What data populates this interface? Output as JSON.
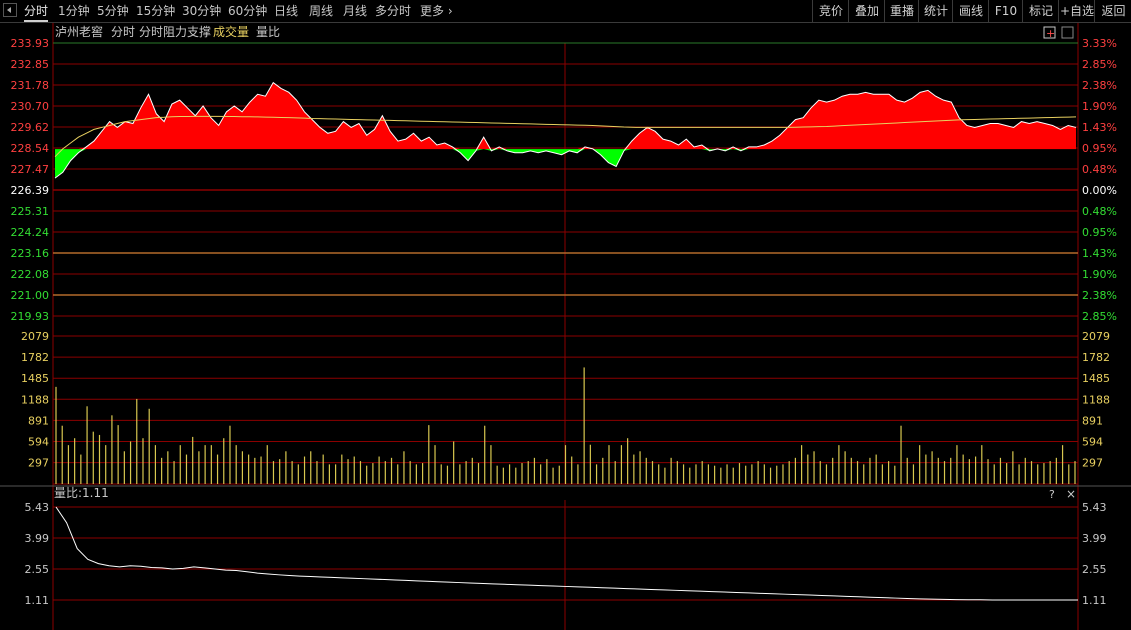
{
  "toolbar": {
    "tabs": [
      "分时",
      "1分钟",
      "5分钟",
      "15分钟",
      "30分钟",
      "60分钟",
      "日线",
      "周线",
      "月线",
      "多分时",
      "更多"
    ],
    "active_tab": "分时",
    "right_buttons": [
      "竞价",
      "叠加",
      "重播",
      "统计",
      "画线",
      "F10",
      "标记",
      "+自选",
      "返回"
    ]
  },
  "price_panel": {
    "stock_name": "泸州老窖",
    "labels": [
      "分时",
      "分时阻力支撑",
      "成交量",
      "量比"
    ],
    "left_axis": [
      "233.93",
      "232.85",
      "231.78",
      "230.70",
      "229.62",
      "228.54",
      "227.47",
      "226.39",
      "225.31",
      "224.24",
      "223.16",
      "222.08",
      "221.00",
      "219.93"
    ],
    "right_axis": [
      "3.33%",
      "2.85%",
      "2.38%",
      "1.90%",
      "1.43%",
      "0.95%",
      "0.48%",
      "0.00%",
      "0.48%",
      "0.95%",
      "1.43%",
      "1.90%",
      "2.38%",
      "2.85%"
    ],
    "prev_close": "226.39",
    "colors": {
      "up": "#ff0000",
      "down": "#00ff00",
      "axis_up": "#ff4040",
      "axis_down": "#33dd33",
      "flat": "#ffffff",
      "grid": "#8b0000",
      "avg_line": "#e8d060"
    }
  },
  "volume_panel": {
    "axis": [
      "2079",
      "1782",
      "1485",
      "1188",
      "891",
      "594",
      "297"
    ],
    "bar_color": "#d8c850"
  },
  "ratio_panel": {
    "title": "量比:1.11",
    "help": "?",
    "close": "×",
    "axis": [
      "5.43",
      "3.99",
      "2.55",
      "1.11"
    ]
  },
  "chart_data": {
    "type": "line",
    "title": "泸州老窖",
    "prev_close": 226.39,
    "price_axis_ylim": [
      219.93,
      233.93
    ],
    "volume_ylim": [
      0,
      2079
    ],
    "ratio_ylim": [
      1.11,
      5.43
    ],
    "price_series": [
      227.0,
      227.3,
      227.9,
      228.3,
      228.6,
      228.9,
      229.4,
      229.9,
      229.6,
      229.9,
      229.8,
      230.6,
      231.3,
      230.3,
      229.9,
      230.8,
      231.0,
      230.6,
      230.2,
      230.7,
      230.1,
      229.7,
      230.4,
      230.7,
      230.4,
      230.9,
      231.3,
      231.2,
      231.9,
      231.6,
      231.4,
      231.0,
      230.4,
      230.0,
      229.6,
      229.3,
      229.4,
      229.9,
      229.6,
      229.8,
      229.2,
      229.5,
      230.2,
      229.4,
      228.9,
      229.0,
      229.3,
      228.9,
      229.1,
      228.7,
      228.8,
      228.6,
      228.3,
      227.9,
      228.4,
      229.1,
      228.4,
      228.6,
      228.4,
      228.3,
      228.3,
      228.4,
      228.3,
      228.4,
      228.3,
      228.2,
      228.4,
      228.3,
      228.6,
      228.5,
      228.2,
      227.8,
      227.6,
      228.4,
      228.9,
      229.3,
      229.6,
      229.4,
      229.0,
      228.9,
      228.7,
      229.0,
      228.6,
      228.7,
      228.4,
      228.5,
      228.4,
      228.6,
      228.4,
      228.6,
      228.6,
      228.7,
      228.9,
      229.2,
      229.6,
      230.0,
      230.1,
      230.6,
      231.0,
      230.9,
      231.0,
      231.2,
      231.3,
      231.3,
      231.4,
      231.3,
      231.3,
      231.3,
      231.0,
      230.9,
      231.1,
      231.4,
      231.5,
      231.2,
      231.0,
      230.9,
      230.1,
      229.7,
      229.6,
      229.7,
      229.8,
      229.8,
      229.7,
      229.6,
      229.9,
      229.8,
      229.9,
      229.8,
      229.7,
      229.5,
      229.7,
      229.6
    ],
    "avg_series": [
      227.5,
      227.9,
      228.2,
      228.5,
      228.7,
      228.9,
      229.0,
      229.1,
      229.2,
      229.3,
      229.35,
      229.4,
      229.45,
      229.5,
      229.52,
      229.55,
      229.56,
      229.56,
      229.57,
      229.57,
      229.57,
      229.57,
      229.56,
      229.56,
      229.55,
      229.55,
      229.54,
      229.53,
      229.52,
      229.51,
      229.5,
      229.49,
      229.48,
      229.46,
      229.45,
      229.44,
      229.43,
      229.42,
      229.41,
      229.4,
      229.39,
      229.38,
      229.37,
      229.36,
      229.35,
      229.34,
      229.33,
      229.32,
      229.31,
      229.3,
      229.29,
      229.28,
      229.27,
      229.26,
      229.25,
      229.24,
      229.23,
      229.22,
      229.21,
      229.2,
      229.19,
      229.18,
      229.17,
      229.16,
      229.15,
      229.14,
      229.13,
      229.12,
      229.11,
      229.1,
      229.08,
      229.06,
      229.04,
      229.02,
      229.01,
      229.0,
      229.0,
      229.0,
      229.0,
      229.0,
      229.0,
      229.0,
      229.0,
      229.0,
      229.0,
      229.0,
      229.0,
      229.0,
      229.0,
      229.0,
      229.0,
      229.0,
      229.0,
      229.0,
      229.0,
      229.01,
      229.02,
      229.03,
      229.04,
      229.05,
      229.07,
      229.09,
      229.11,
      229.13,
      229.15,
      229.17,
      229.19,
      229.21,
      229.23,
      229.25,
      229.27,
      229.29,
      229.31,
      229.33,
      229.35,
      229.37,
      229.39,
      229.4,
      229.41,
      229.42,
      229.43,
      229.44,
      229.45,
      229.46,
      229.47,
      229.48,
      229.49,
      229.5,
      229.51,
      229.52,
      229.53,
      229.54
    ],
    "volume_series": [
      1485,
      891,
      594,
      700,
      450,
      1188,
      800,
      750,
      594,
      1050,
      900,
      500,
      650,
      1300,
      700,
      1150,
      594,
      400,
      500,
      350,
      594,
      450,
      720,
      500,
      594,
      594,
      450,
      700,
      891,
      594,
      500,
      450,
      400,
      420,
      594,
      350,
      380,
      500,
      350,
      300,
      420,
      500,
      350,
      450,
      300,
      300,
      450,
      380,
      420,
      350,
      280,
      320,
      420,
      350,
      400,
      300,
      500,
      350,
      300,
      320,
      900,
      594,
      300,
      280,
      650,
      300,
      350,
      400,
      320,
      891,
      594,
      280,
      250,
      300,
      250,
      320,
      350,
      400,
      300,
      380,
      250,
      280,
      594,
      420,
      300,
      1782,
      600,
      300,
      400,
      594,
      350,
      594,
      700,
      450,
      500,
      400,
      350,
      300,
      250,
      400,
      350,
      300,
      250,
      300,
      350,
      300,
      280,
      250,
      300,
      250,
      320,
      280,
      300,
      350,
      300,
      250,
      280,
      300,
      350,
      400,
      594,
      450,
      500,
      350,
      300,
      400,
      594,
      500,
      400,
      350,
      300,
      400,
      450,
      300,
      350,
      280,
      891,
      400,
      300,
      594,
      450,
      500,
      400,
      350,
      400,
      594,
      450,
      380,
      420,
      594,
      380,
      300,
      400,
      320,
      500,
      300,
      400,
      350,
      300,
      320,
      350,
      400,
      594,
      300,
      350
    ],
    "ratio_series": [
      5.43,
      4.7,
      3.5,
      3.0,
      2.8,
      2.7,
      2.65,
      2.7,
      2.68,
      2.62,
      2.6,
      2.55,
      2.58,
      2.65,
      2.6,
      2.55,
      2.5,
      2.48,
      2.42,
      2.36,
      2.32,
      2.28,
      2.25,
      2.22,
      2.2,
      2.18,
      2.16,
      2.14,
      2.12,
      2.1,
      2.08,
      2.06,
      2.04,
      2.02,
      2.0,
      1.98,
      1.96,
      1.94,
      1.92,
      1.9,
      1.88,
      1.86,
      1.84,
      1.82,
      1.8,
      1.78,
      1.76,
      1.74,
      1.72,
      1.7,
      1.68,
      1.66,
      1.64,
      1.62,
      1.6,
      1.58,
      1.56,
      1.54,
      1.52,
      1.5,
      1.48,
      1.46,
      1.44,
      1.42,
      1.4,
      1.38,
      1.36,
      1.34,
      1.32,
      1.3,
      1.28,
      1.26,
      1.24,
      1.22,
      1.2,
      1.18,
      1.16,
      1.15,
      1.14,
      1.13,
      1.12,
      1.12,
      1.11,
      1.11,
      1.11,
      1.11,
      1.11,
      1.11,
      1.11,
      1.11
    ]
  }
}
